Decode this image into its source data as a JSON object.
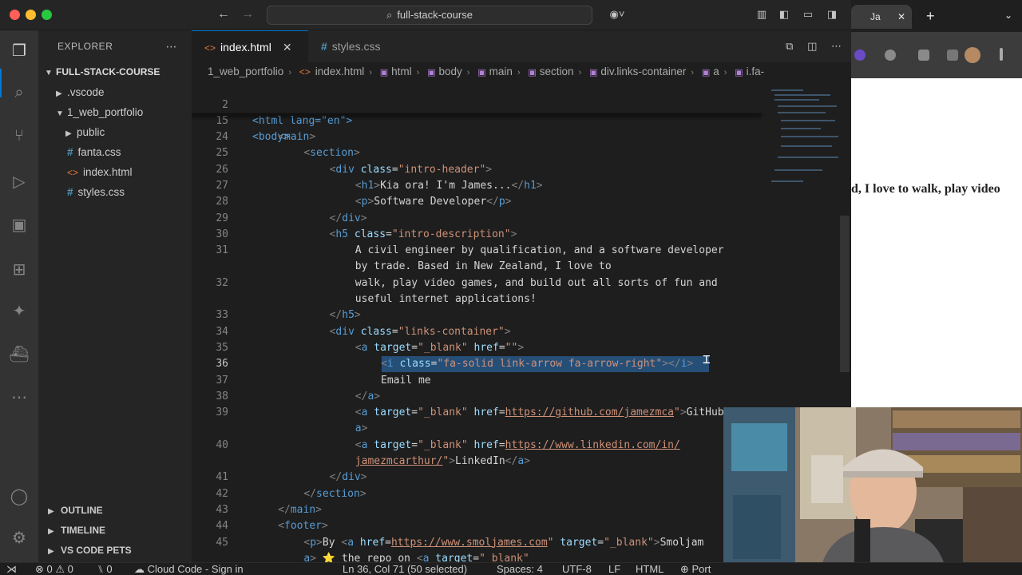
{
  "window": {
    "search_title": "full-stack-course"
  },
  "sidebar": {
    "header": "EXPLORER",
    "root": "FULL-STACK-COURSE",
    "items": [
      {
        "label": ".vscode",
        "type": "folder"
      },
      {
        "label": "1_web_portfolio",
        "type": "folder-open"
      },
      {
        "label": "public",
        "type": "folder"
      },
      {
        "label": "fanta.css",
        "type": "css"
      },
      {
        "label": "index.html",
        "type": "html"
      },
      {
        "label": "styles.css",
        "type": "css"
      }
    ],
    "sections": [
      "OUTLINE",
      "TIMELINE",
      "VS CODE PETS"
    ]
  },
  "tabs": [
    {
      "label": "index.html",
      "icon": "html-icon"
    },
    {
      "label": "styles.css",
      "icon": "css-hash-icon"
    }
  ],
  "breadcrumb": [
    "1_web_portfolio",
    "index.html",
    "html",
    "body",
    "main",
    "section",
    "div.links-container",
    "a",
    "i.fa-"
  ],
  "sticky": [
    {
      "num": "2",
      "text": "<html lang=\"en\">"
    },
    {
      "num": "15",
      "text": "<body>"
    }
  ],
  "code": {
    "lines": [
      {
        "num": "24",
        "indent": 4,
        "tokens": [
          [
            "punct",
            "<"
          ],
          [
            "tag",
            "main"
          ],
          [
            "punct",
            ">"
          ]
        ]
      },
      {
        "num": "25",
        "indent": 8,
        "tokens": [
          [
            "punct",
            "<"
          ],
          [
            "tag",
            "section"
          ],
          [
            "punct",
            ">"
          ]
        ]
      },
      {
        "num": "26",
        "indent": 12,
        "tokens": [
          [
            "punct",
            "<"
          ],
          [
            "tag",
            "div"
          ],
          [
            "txt",
            " "
          ],
          [
            "attr",
            "class"
          ],
          [
            "txt",
            "="
          ],
          [
            "str",
            "\"intro-header\""
          ],
          [
            "punct",
            ">"
          ]
        ]
      },
      {
        "num": "27",
        "indent": 16,
        "tokens": [
          [
            "punct",
            "<"
          ],
          [
            "tag",
            "h1"
          ],
          [
            "punct",
            ">"
          ],
          [
            "txt",
            "Kia ora! I'm James..."
          ],
          [
            "punct",
            "</"
          ],
          [
            "tag",
            "h1"
          ],
          [
            "punct",
            ">"
          ]
        ]
      },
      {
        "num": "28",
        "indent": 16,
        "tokens": [
          [
            "punct",
            "<"
          ],
          [
            "tag",
            "p"
          ],
          [
            "punct",
            ">"
          ],
          [
            "txt",
            "Software Developer"
          ],
          [
            "punct",
            "</"
          ],
          [
            "tag",
            "p"
          ],
          [
            "punct",
            ">"
          ]
        ]
      },
      {
        "num": "29",
        "indent": 12,
        "tokens": [
          [
            "punct",
            "</"
          ],
          [
            "tag",
            "div"
          ],
          [
            "punct",
            ">"
          ]
        ]
      },
      {
        "num": "30",
        "indent": 12,
        "tokens": [
          [
            "punct",
            "<"
          ],
          [
            "tag",
            "h5"
          ],
          [
            "txt",
            " "
          ],
          [
            "attr",
            "class"
          ],
          [
            "txt",
            "="
          ],
          [
            "str",
            "\"intro-description\""
          ],
          [
            "punct",
            ">"
          ]
        ]
      },
      {
        "num": "31",
        "indent": 16,
        "tokens": [
          [
            "txt",
            "A civil engineer by qualification, and a software developer"
          ]
        ]
      },
      {
        "num": "",
        "indent": 16,
        "tokens": [
          [
            "txt",
            "by trade. Based in New Zealand, I love to"
          ]
        ]
      },
      {
        "num": "32",
        "indent": 16,
        "tokens": [
          [
            "txt",
            "walk, play video games, and build out all sorts of fun and"
          ]
        ]
      },
      {
        "num": "",
        "indent": 16,
        "tokens": [
          [
            "txt",
            "useful internet applications!"
          ]
        ]
      },
      {
        "num": "33",
        "indent": 12,
        "tokens": [
          [
            "punct",
            "</"
          ],
          [
            "tag",
            "h5"
          ],
          [
            "punct",
            ">"
          ]
        ]
      },
      {
        "num": "34",
        "indent": 12,
        "tokens": [
          [
            "punct",
            "<"
          ],
          [
            "tag",
            "div"
          ],
          [
            "txt",
            " "
          ],
          [
            "attr",
            "class"
          ],
          [
            "txt",
            "="
          ],
          [
            "str",
            "\"links-container\""
          ],
          [
            "punct",
            ">"
          ]
        ]
      },
      {
        "num": "35",
        "indent": 16,
        "tokens": [
          [
            "punct",
            "<"
          ],
          [
            "tag",
            "a"
          ],
          [
            "txt",
            " "
          ],
          [
            "attr",
            "target"
          ],
          [
            "txt",
            "="
          ],
          [
            "str",
            "\"_blank\""
          ],
          [
            "txt",
            " "
          ],
          [
            "attr",
            "href"
          ],
          [
            "txt",
            "="
          ],
          [
            "str",
            "\"\""
          ],
          [
            "punct",
            ">"
          ]
        ]
      },
      {
        "num": "36",
        "indent": 20,
        "current": true,
        "tokens": [
          [
            "punct",
            "<"
          ],
          [
            "tag",
            "i"
          ],
          [
            "txt",
            " "
          ],
          [
            "attr",
            "class"
          ],
          [
            "txt",
            "="
          ],
          [
            "str",
            "\"fa-solid link-arrow fa-arrow-right\""
          ],
          [
            "punct",
            "></"
          ],
          [
            "tag",
            "i"
          ],
          [
            "punct",
            ">"
          ]
        ]
      },
      {
        "num": "37",
        "indent": 20,
        "tokens": [
          [
            "txt",
            "Email me"
          ]
        ]
      },
      {
        "num": "38",
        "indent": 16,
        "tokens": [
          [
            "punct",
            "</"
          ],
          [
            "tag",
            "a"
          ],
          [
            "punct",
            ">"
          ]
        ]
      },
      {
        "num": "39",
        "indent": 16,
        "tokens": [
          [
            "punct",
            "<"
          ],
          [
            "tag",
            "a"
          ],
          [
            "txt",
            " "
          ],
          [
            "attr",
            "target"
          ],
          [
            "txt",
            "="
          ],
          [
            "str",
            "\"_blank\""
          ],
          [
            "txt",
            " "
          ],
          [
            "attr",
            "href"
          ],
          [
            "txt",
            "="
          ],
          [
            "link",
            "https://github.com/jamezmca"
          ],
          [
            "str",
            "\""
          ],
          [
            "punct",
            ">"
          ],
          [
            "txt",
            "GitHub</"
          ]
        ]
      },
      {
        "num": "",
        "indent": 16,
        "tokens": [
          [
            "tag",
            "a"
          ],
          [
            "punct",
            ">"
          ]
        ]
      },
      {
        "num": "40",
        "indent": 16,
        "tokens": [
          [
            "punct",
            "<"
          ],
          [
            "tag",
            "a"
          ],
          [
            "txt",
            " "
          ],
          [
            "attr",
            "target"
          ],
          [
            "txt",
            "="
          ],
          [
            "str",
            "\"_blank\""
          ],
          [
            "txt",
            " "
          ],
          [
            "attr",
            "href"
          ],
          [
            "txt",
            "="
          ],
          [
            "link",
            "https://www.linkedin.com/in/"
          ]
        ]
      },
      {
        "num": "",
        "indent": 16,
        "tokens": [
          [
            "link",
            "jamezmcarthur/"
          ],
          [
            "str",
            "\""
          ],
          [
            "punct",
            ">"
          ],
          [
            "txt",
            "LinkedIn"
          ],
          [
            "punct",
            "</"
          ],
          [
            "tag",
            "a"
          ],
          [
            "punct",
            ">"
          ]
        ]
      },
      {
        "num": "41",
        "indent": 12,
        "tokens": [
          [
            "punct",
            "</"
          ],
          [
            "tag",
            "div"
          ],
          [
            "punct",
            ">"
          ]
        ]
      },
      {
        "num": "42",
        "indent": 8,
        "tokens": [
          [
            "punct",
            "</"
          ],
          [
            "tag",
            "section"
          ],
          [
            "punct",
            ">"
          ]
        ]
      },
      {
        "num": "43",
        "indent": 4,
        "tokens": [
          [
            "punct",
            "</"
          ],
          [
            "tag",
            "main"
          ],
          [
            "punct",
            ">"
          ]
        ]
      },
      {
        "num": "44",
        "indent": 4,
        "tokens": [
          [
            "punct",
            "<"
          ],
          [
            "tag",
            "footer"
          ],
          [
            "punct",
            ">"
          ]
        ]
      },
      {
        "num": "45",
        "indent": 8,
        "tokens": [
          [
            "punct",
            "<"
          ],
          [
            "tag",
            "p"
          ],
          [
            "punct",
            ">"
          ],
          [
            "txt",
            "By "
          ],
          [
            "punct",
            "<"
          ],
          [
            "tag",
            "a"
          ],
          [
            "txt",
            " "
          ],
          [
            "attr",
            "href"
          ],
          [
            "txt",
            "="
          ],
          [
            "link",
            "https://www.smoljames.com"
          ],
          [
            "str",
            "\""
          ],
          [
            "txt",
            " "
          ],
          [
            "attr",
            "target"
          ],
          [
            "txt",
            "="
          ],
          [
            "str",
            "\"_blank\""
          ],
          [
            "punct",
            ">"
          ],
          [
            "txt",
            "Smoljam"
          ]
        ]
      },
      {
        "num": "",
        "indent": 8,
        "tokens": [
          [
            "tag",
            "a"
          ],
          [
            "punct",
            ">"
          ],
          [
            "txt",
            " ⭐ the repo on "
          ],
          [
            "punct",
            "<"
          ],
          [
            "tag",
            "a"
          ],
          [
            "txt",
            " "
          ],
          [
            "attr",
            "target"
          ],
          [
            "txt",
            "="
          ],
          [
            "str",
            "\"_blank\""
          ]
        ]
      }
    ]
  },
  "status": {
    "remote": "⋊",
    "errors": "0",
    "warnings": "0",
    "ports": "0",
    "cloud": "Cloud Code - Sign in",
    "position": "Ln 36, Col 71 (50 selected)",
    "spaces": "Spaces: 4",
    "encoding": "UTF-8",
    "eol": "LF",
    "language": "HTML",
    "port": "Port"
  },
  "browser": {
    "tab_label": "Ja",
    "content_snippet": "d, I love to walk, play video"
  },
  "colors": {
    "accent": "#0078d4",
    "tag": "#569cd6",
    "attr": "#9cdcfe",
    "string": "#ce9178",
    "selection": "#264f78"
  }
}
